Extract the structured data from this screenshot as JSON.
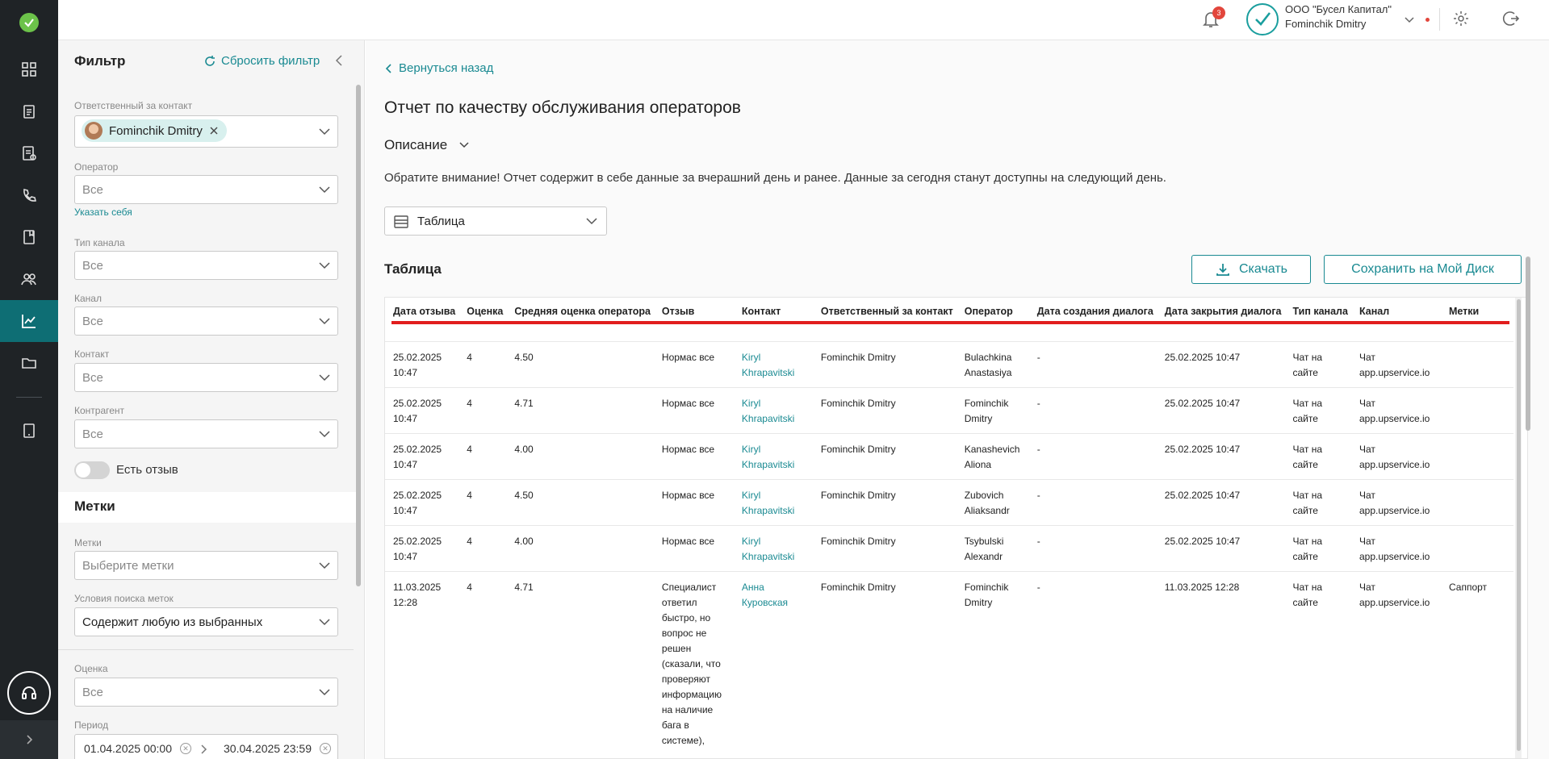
{
  "topbar": {
    "notifications_count": "3",
    "org_name": "ООО \"Бусел Капитал\"",
    "user_name": "Fominchik Dmitry"
  },
  "filter": {
    "title": "Фильтр",
    "reset": "Сбросить фильтр",
    "responsible_label": "Ответственный за контакт",
    "responsible_chip": "Fominchik Dmitry",
    "operator_label": "Оператор",
    "operator_value": "Все",
    "assign_self": "Указать себя",
    "channel_type_label": "Тип канала",
    "channel_type_value": "Все",
    "channel_label": "Канал",
    "channel_value": "Все",
    "contact_label": "Контакт",
    "contact_value": "Все",
    "counterparty_label": "Контрагент",
    "counterparty_value": "Все",
    "has_review_label": "Есть отзыв",
    "tags_section": "Метки",
    "tags_label": "Метки",
    "tags_placeholder": "Выберите метки",
    "tag_search_label": "Условия поиска меток",
    "tag_search_value": "Содержит любую из выбранных",
    "rating_label": "Оценка",
    "rating_value": "Все",
    "period_label": "Период",
    "period_from": "01.04.2025 00:00",
    "period_to": "30.04.2025 23:59"
  },
  "main": {
    "back": "Вернуться назад",
    "title": "Отчет по качеству обслуживания операторов",
    "description": "Описание",
    "notice": "Обратите внимание! Отчет содержит в себе данные за вчерашний день и ранее. Данные за сегодня станут доступны на следующий день.",
    "view_select": "Таблица",
    "table_title": "Таблица",
    "download": "Скачать",
    "save_disk": "Сохранить на Мой Диск"
  },
  "table": {
    "headers": [
      "Дата отзыва",
      "Оценка",
      "Средняя оценка оператора",
      "Отзыв",
      "Контакт",
      "Ответственный за контакт",
      "Оператор",
      "Дата создания диалога",
      "Дата закрытия диалога",
      "Тип канала",
      "Канал",
      "Метки"
    ],
    "rows": [
      {
        "date": "25.02.2025 10:47",
        "rating": "4",
        "avg": "4.50",
        "review": "Нормас все",
        "contact": "Kiryl Khrapavitski",
        "responsible": "Fominchik Dmitry",
        "operator": "Bulachkina Anastasiya",
        "created": "-",
        "closed": "25.02.2025 10:47",
        "channel_type": "Чат на сайте",
        "channel": "Чат app.upservice.io",
        "tags": ""
      },
      {
        "date": "25.02.2025 10:47",
        "rating": "4",
        "avg": "4.71",
        "review": "Нормас все",
        "contact": "Kiryl Khrapavitski",
        "responsible": "Fominchik Dmitry",
        "operator": "Fominchik Dmitry",
        "created": "-",
        "closed": "25.02.2025 10:47",
        "channel_type": "Чат на сайте",
        "channel": "Чат app.upservice.io",
        "tags": ""
      },
      {
        "date": "25.02.2025 10:47",
        "rating": "4",
        "avg": "4.00",
        "review": "Нормас все",
        "contact": "Kiryl Khrapavitski",
        "responsible": "Fominchik Dmitry",
        "operator": "Kanashevich Aliona",
        "created": "-",
        "closed": "25.02.2025 10:47",
        "channel_type": "Чат на сайте",
        "channel": "Чат app.upservice.io",
        "tags": ""
      },
      {
        "date": "25.02.2025 10:47",
        "rating": "4",
        "avg": "4.50",
        "review": "Нормас все",
        "contact": "Kiryl Khrapavitski",
        "responsible": "Fominchik Dmitry",
        "operator": "Zubovich Aliaksandr",
        "created": "-",
        "closed": "25.02.2025 10:47",
        "channel_type": "Чат на сайте",
        "channel": "Чат app.upservice.io",
        "tags": ""
      },
      {
        "date": "25.02.2025 10:47",
        "rating": "4",
        "avg": "4.00",
        "review": "Нормас все",
        "contact": "Kiryl Khrapavitski",
        "responsible": "Fominchik Dmitry",
        "operator": "Tsybulski Alexandr",
        "created": "-",
        "closed": "25.02.2025 10:47",
        "channel_type": "Чат на сайте",
        "channel": "Чат app.upservice.io",
        "tags": ""
      },
      {
        "date": "11.03.2025 12:28",
        "rating": "4",
        "avg": "4.71",
        "review": "Специалист ответил быстро, но вопрос не решен (сказали, что проверяют информацию на наличие бага в системе),",
        "contact": "Анна Куровская",
        "responsible": "Fominchik Dmitry",
        "operator": "Fominchik Dmitry",
        "created": "-",
        "closed": "11.03.2025 12:28",
        "channel_type": "Чат на сайте",
        "channel": "Чат app.upservice.io",
        "tags": "Саппорт"
      }
    ]
  },
  "colors": {
    "accent": "#1a8a92",
    "rail": "#1f2326",
    "highlight": "#e11d1d"
  }
}
